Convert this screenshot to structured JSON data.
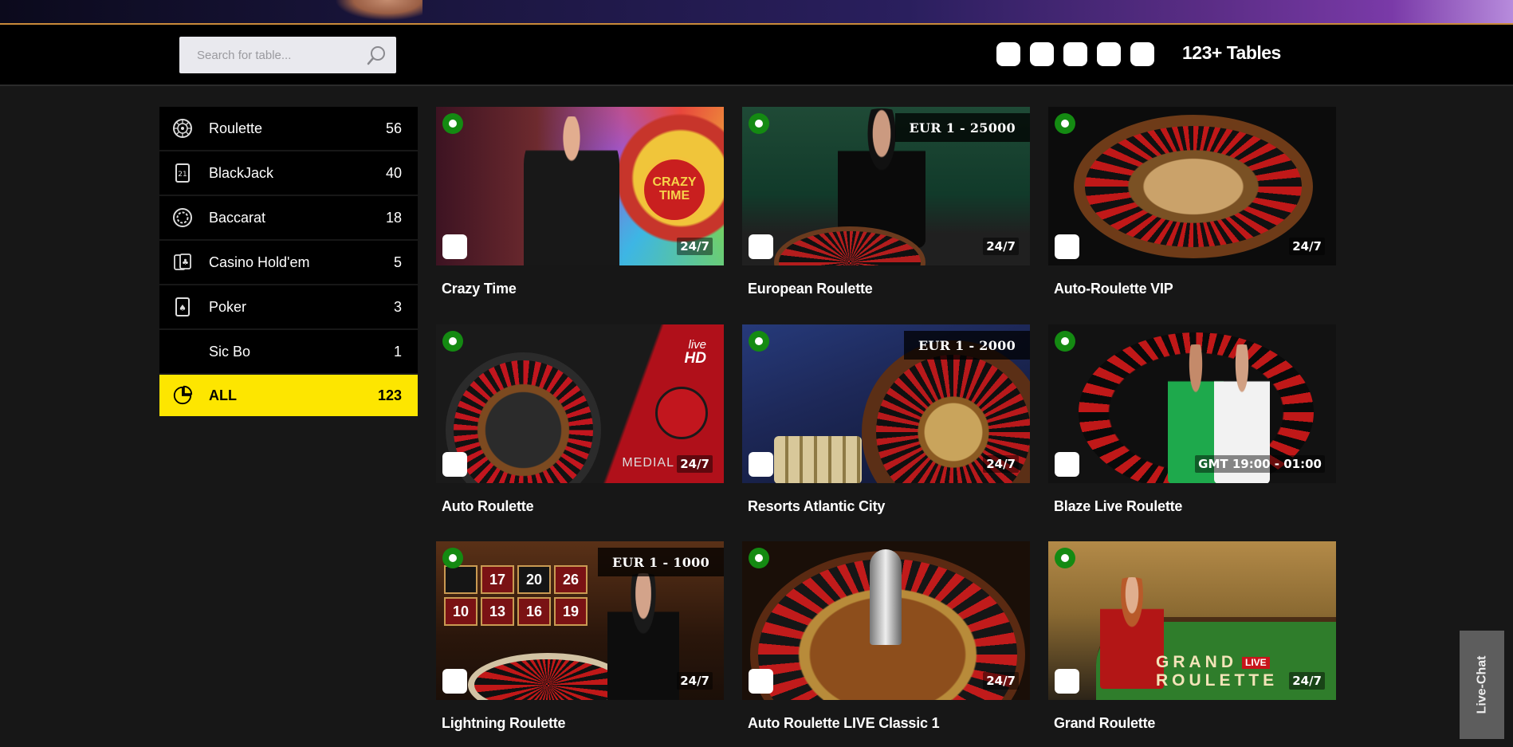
{
  "header": {
    "search_placeholder": "Search for table...",
    "tables_count": "123+ Tables",
    "language_flags": [
      "flag-1",
      "flag-2",
      "flag-3",
      "flag-4",
      "flag-5"
    ]
  },
  "sidebar": {
    "categories": [
      {
        "label": "Roulette",
        "count": "56",
        "icon": "roulette-wheel-icon"
      },
      {
        "label": "BlackJack",
        "count": "40",
        "icon": "blackjack-card-icon"
      },
      {
        "label": "Baccarat",
        "count": "18",
        "icon": "baccarat-chip-icon"
      },
      {
        "label": "Casino Hold'em",
        "count": "5",
        "icon": "holdem-cards-icon"
      },
      {
        "label": "Poker",
        "count": "3",
        "icon": "poker-card-icon"
      },
      {
        "label": "Sic Bo",
        "count": "1",
        "icon": ""
      },
      {
        "label": "ALL",
        "count": "123",
        "icon": "all-games-icon"
      }
    ],
    "active_color": "#fde600"
  },
  "tables": [
    {
      "title": "Crazy Time",
      "hours": "24/7",
      "limit": ""
    },
    {
      "title": "European Roulette",
      "hours": "24/7",
      "limit": "EUR 1 - 25000"
    },
    {
      "title": "Auto-Roulette VIP",
      "hours": "24/7",
      "limit": ""
    },
    {
      "title": "Auto Roulette",
      "hours": "24/7",
      "limit": ""
    },
    {
      "title": "Resorts Atlantic City",
      "hours": "24/7",
      "limit": "EUR 1 - 2000"
    },
    {
      "title": "Blaze Live Roulette",
      "hours": "GMT 19:00 - 01:00",
      "limit": ""
    },
    {
      "title": "Lightning Roulette",
      "hours": "24/7",
      "limit": "EUR 1 - 1000"
    },
    {
      "title": "Auto Roulette LIVE Classic 1",
      "hours": "24/7",
      "limit": ""
    },
    {
      "title": "Grand Roulette",
      "hours": "24/7",
      "limit": ""
    }
  ],
  "thumb_text": {
    "crazy_time": [
      "CRAZY",
      "TIME"
    ],
    "live_hd": [
      "live",
      "HD"
    ],
    "medial": "MEDIAL",
    "lightning_numbers": [
      "17",
      "20",
      "26",
      "",
      "10",
      "13",
      "16",
      "19"
    ],
    "grand_roulette": [
      "GRAND",
      "ROULETTE",
      "LIVE"
    ]
  },
  "live_chat": {
    "label": "Live-Chat"
  },
  "colors": {
    "live_dot": "#148a12",
    "accent": "#fde600",
    "background": "#171717"
  }
}
